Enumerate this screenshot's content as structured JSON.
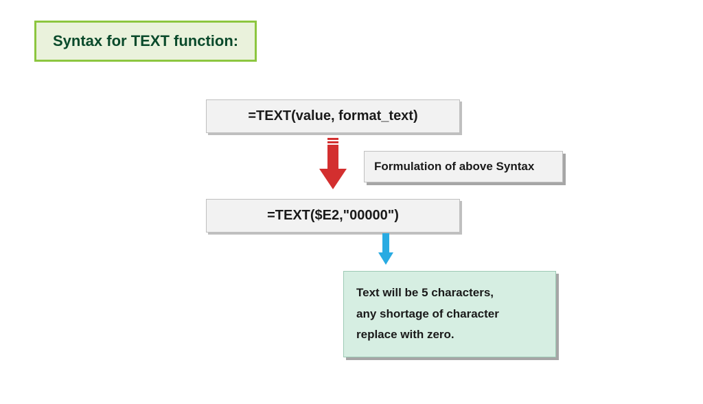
{
  "title": "Syntax for TEXT function:",
  "syntax_formula": "=TEXT(value, format_text)",
  "callout_formulation": "Formulation of above Syntax",
  "example_formula": "=TEXT($E2,\"00000\")",
  "result_line1": "Text will be 5 characters,",
  "result_line2": "any shortage of character",
  "result_line3": "replace with zero.",
  "colors": {
    "title_bg": "#eaf2dc",
    "title_border": "#8cc63f",
    "box_bg": "#f2f2f2",
    "box_border": "#bfbfbf",
    "result_bg": "#d6eee2",
    "arrow_red": "#d32f2f",
    "arrow_blue": "#29abe2"
  }
}
